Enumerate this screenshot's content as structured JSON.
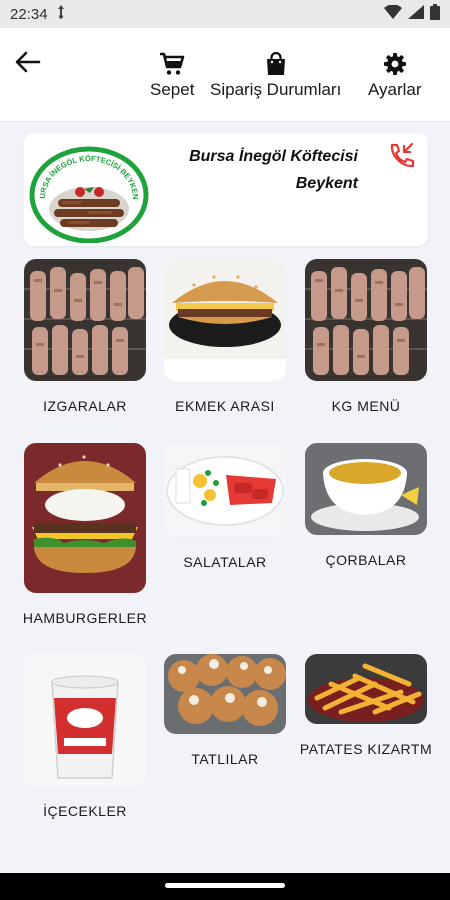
{
  "status_bar": {
    "time": "22:34"
  },
  "app_bar": {
    "back_label": "back",
    "actions": [
      {
        "label": "Sepet",
        "icon": "cart-icon"
      },
      {
        "label": "Sipariş Durumları",
        "icon": "shopping-bag-icon"
      },
      {
        "label": "Ayarlar",
        "icon": "gear-icon"
      }
    ]
  },
  "restaurant": {
    "name_line1": "Bursa İnegöl Köftecisi",
    "name_line2": "Beykent",
    "logo_text": "BURSA İNEGÖL KÖFTECİSİ BEYKENT",
    "call_icon": "phone-callback-icon"
  },
  "categories": [
    {
      "label": "IZGARALAR"
    },
    {
      "label": "EKMEK ARASI"
    },
    {
      "label": "KG MENÜ"
    },
    {
      "label": "HAMBURGERLER"
    },
    {
      "label": "SALATALAR"
    },
    {
      "label": "ÇORBALAR"
    },
    {
      "label": "İÇECEKLER"
    },
    {
      "label": "TATLILAR"
    },
    {
      "label": "PATATES KIZARTM"
    }
  ],
  "colors": {
    "accent_red": "#e53935",
    "logo_green": "#1ea33b",
    "background": "#f1f3f8"
  }
}
